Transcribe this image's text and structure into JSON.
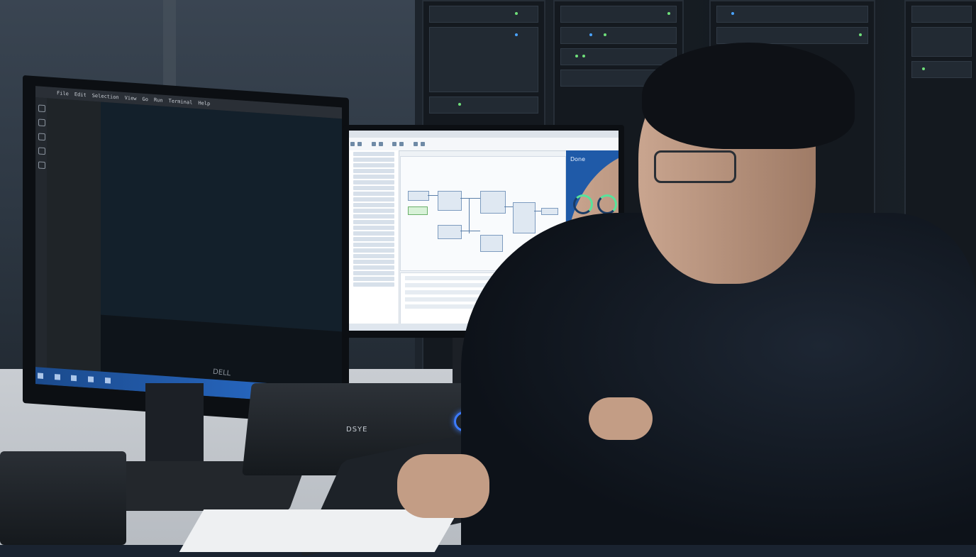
{
  "scene": "developer at dual-monitor workstation in server room",
  "left_monitor": {
    "menu": [
      "File",
      "Edit",
      "Selection",
      "View",
      "Go",
      "Run",
      "Terminal",
      "Help"
    ],
    "brand": "DELL"
  },
  "right_monitor": {
    "panel_title": "Done"
  },
  "device": {
    "label": "DSYE"
  },
  "colors": {
    "editor_bg": "#13202b",
    "taskbar": "#2a6fcf",
    "accent_ring": "#3c7bff",
    "side_panel": "#1f5aa8"
  }
}
